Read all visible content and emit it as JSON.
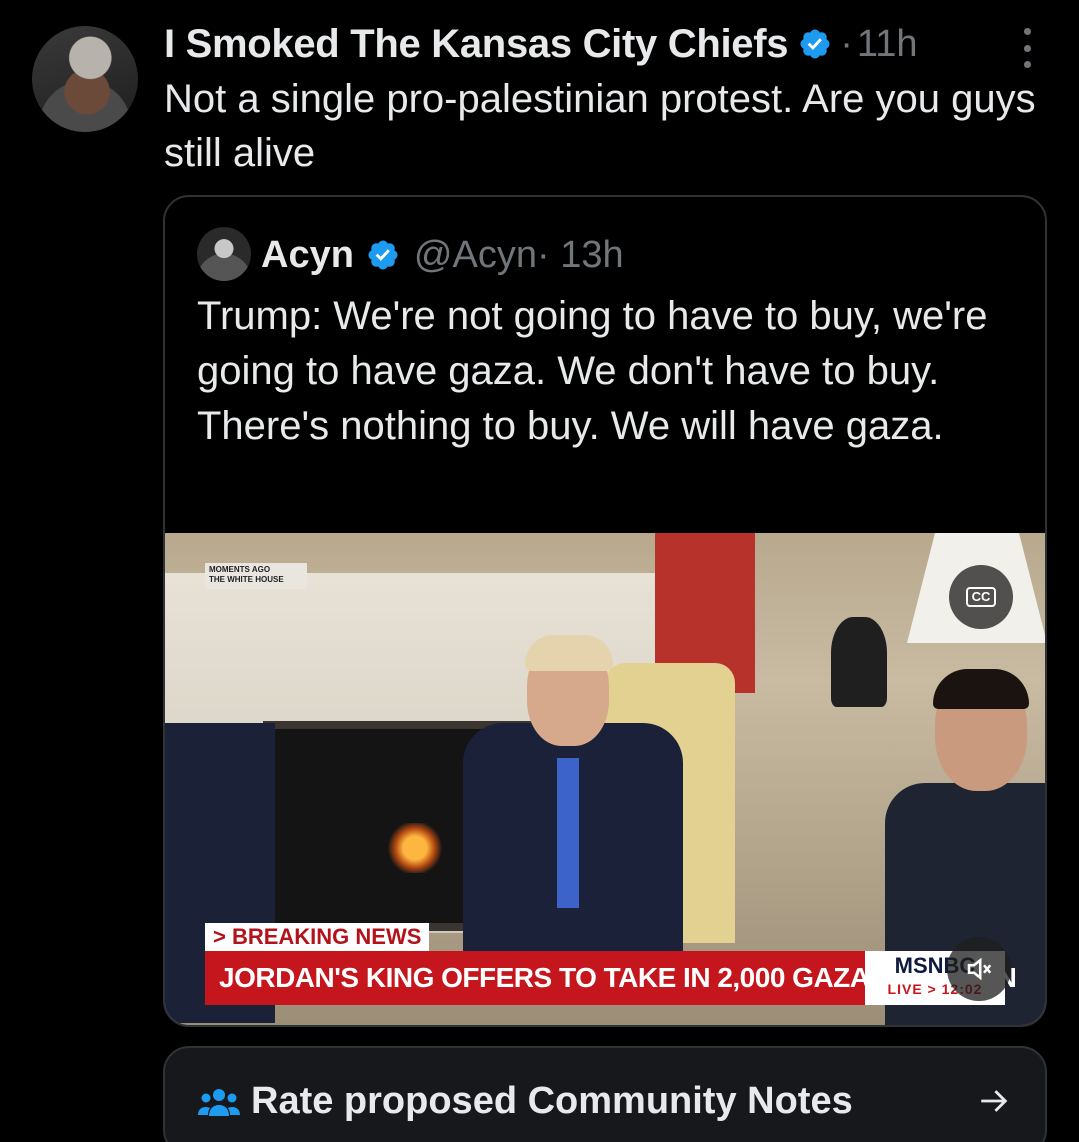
{
  "post": {
    "author_name": "I Smoked The Kansas City Chiefs",
    "separator": "·",
    "time": "11h",
    "text": "Not a single pro-palestinian protest. Are you guys still alive"
  },
  "quote": {
    "author_name": "Acyn",
    "handle": "@Acyn",
    "time": "· 13h",
    "text": "Trump: We're not going to have to buy, we're going to have gaza. We don't have to buy. There's nothing to buy. We will have gaza."
  },
  "video": {
    "overlay_line1": "MOMENTS AGO",
    "overlay_line2": "THE WHITE HOUSE",
    "cc_label": "CC",
    "breaking_label": "> BREAKING NEWS",
    "headline": "JORDAN'S KING OFFERS TO TAKE IN 2,000 GAZA CHILDREN",
    "network": "MSNBC",
    "live_label": "LIVE > 12:02"
  },
  "community_notes": {
    "label": "Rate proposed Community Notes"
  },
  "colors": {
    "background": "#000000",
    "text": "#e7e9ea",
    "muted": "#71767b",
    "verified": "#1d9bf0",
    "border": "#2f3336"
  }
}
